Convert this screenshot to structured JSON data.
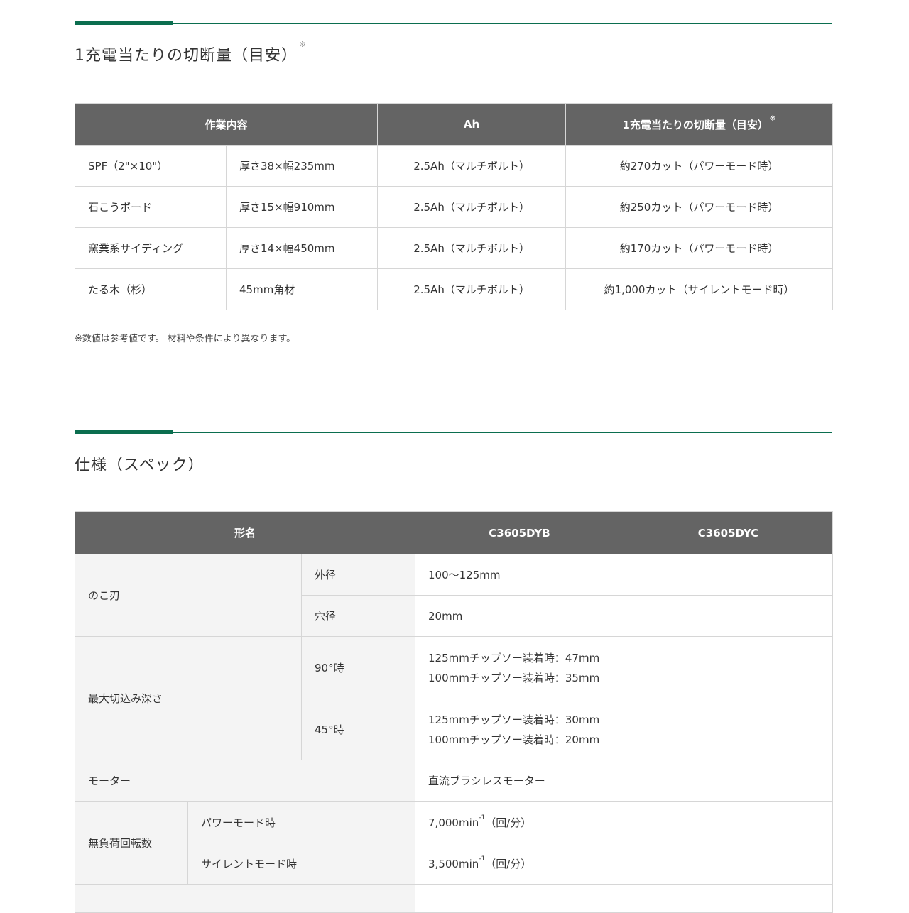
{
  "cutting": {
    "title": "1充電当たりの切断量（目安）",
    "title_mark": "※",
    "headers": {
      "work": "作業内容",
      "ah": "Ah",
      "amount": "1充電当たりの切断量（目安）",
      "amount_mark": "※"
    },
    "rows": [
      {
        "material": "SPF（2\"×10\"）",
        "size": "厚さ38×幅235mm",
        "battery": "2.5Ah（マルチボルト）",
        "amount": "約270カット（パワーモード時）"
      },
      {
        "material": "石こうボード",
        "size": "厚さ15×幅910mm",
        "battery": "2.5Ah（マルチボルト）",
        "amount": "約250カット（パワーモード時）"
      },
      {
        "material": "窯業系サイディング",
        "size": "厚さ14×幅450mm",
        "battery": "2.5Ah（マルチボルト）",
        "amount": "約170カット（パワーモード時）"
      },
      {
        "material": "たる木（杉）",
        "size": "45mm角材",
        "battery": "2.5Ah（マルチボルト）",
        "amount": "約1,000カット（サイレントモード時）"
      }
    ],
    "note": "※数値は参考値です。 材料や条件により異なります。"
  },
  "spec": {
    "title": "仕様（スペック）",
    "headers": {
      "model": "形名",
      "col1": "C3605DYB",
      "col2": "C3605DYC"
    },
    "saw": {
      "label": "のこ刃",
      "outer_label": "外径",
      "outer_value": "100～125mm",
      "hole_label": "穴径",
      "hole_value": "20mm"
    },
    "depth": {
      "label": "最大切込み深さ",
      "deg90_label": "90°時",
      "deg90_line1": "125mmチップソー装着時：47mm",
      "deg90_line2": "100mmチップソー装着時：35mm",
      "deg45_label": "45°時",
      "deg45_line1": "125mmチップソー装着時：30mm",
      "deg45_line2": "100mmチップソー装着時：20mm"
    },
    "motor": {
      "label": "モーター",
      "value": "直流ブラシレスモーター"
    },
    "speed": {
      "label": "無負荷回転数",
      "power_label": "パワーモード時",
      "power_value": "7,000min",
      "power_unit": "-1",
      "power_suffix": "（回/分）",
      "silent_label": "サイレントモード時",
      "silent_value": "3,500min",
      "silent_unit": "-1",
      "silent_suffix": "（回/分）"
    }
  }
}
